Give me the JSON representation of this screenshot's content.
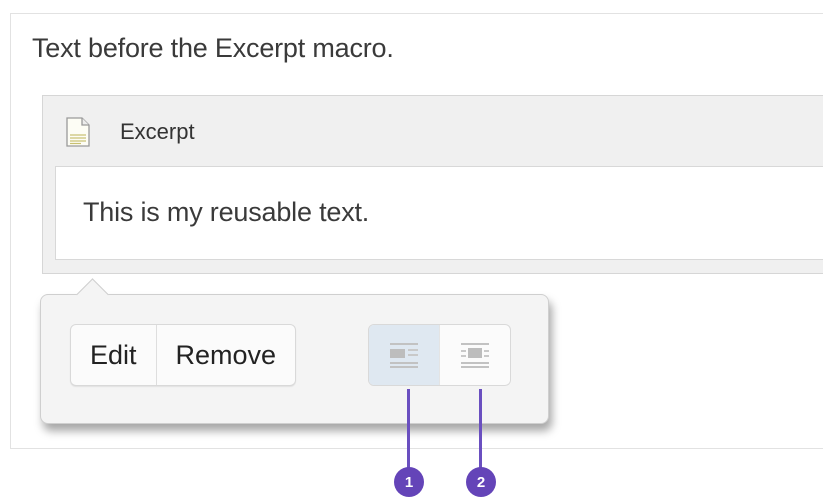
{
  "editor": {
    "intro_text": "Text before the Excerpt macro."
  },
  "macro": {
    "title": "Excerpt",
    "icon": "document-icon",
    "body_text": "This is my reusable text."
  },
  "toolbar": {
    "edit_label": "Edit",
    "remove_label": "Remove",
    "align_buttons": [
      {
        "name": "align-left",
        "icon": "align-left-icon",
        "active": true
      },
      {
        "name": "align-center",
        "icon": "align-center-icon",
        "active": false
      }
    ]
  },
  "callouts": [
    {
      "label": "1"
    },
    {
      "label": "2"
    }
  ],
  "colors": {
    "callout": "#6444b8",
    "active_align_bg": "#dfe8f1"
  }
}
